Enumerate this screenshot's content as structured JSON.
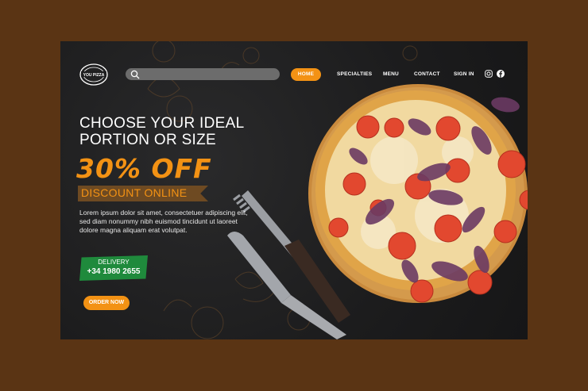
{
  "header": {
    "logo_text": "YOU PIZZA",
    "search": {
      "placeholder": ""
    },
    "nav": [
      "HOME",
      "SPECIALTIES",
      "MENU",
      "CONTACT",
      "SIGN IN"
    ],
    "social": [
      "instagram-icon",
      "facebook-icon"
    ]
  },
  "hero": {
    "title_line1": "CHOOSE YOUR IDEAL",
    "title_line2": "PORTION OR SIZE",
    "discount": "30% OFF",
    "ribbon": "DISCOUNT ONLINE",
    "description": "Lorem ipsum dolor sit amet, consectetuer adipiscing elit, sed diam nonummy nibh euismod tincidunt ut laoreet dolore magna aliquam erat volutpat.",
    "delivery_label": "DELIVERY",
    "delivery_phone": "+34 1980 2655",
    "cta": "ORDER NOW"
  },
  "colors": {
    "accent": "#f39214",
    "background": "#5a3414",
    "panel": "#1e1e1f",
    "delivery": "#1f8a3c"
  }
}
